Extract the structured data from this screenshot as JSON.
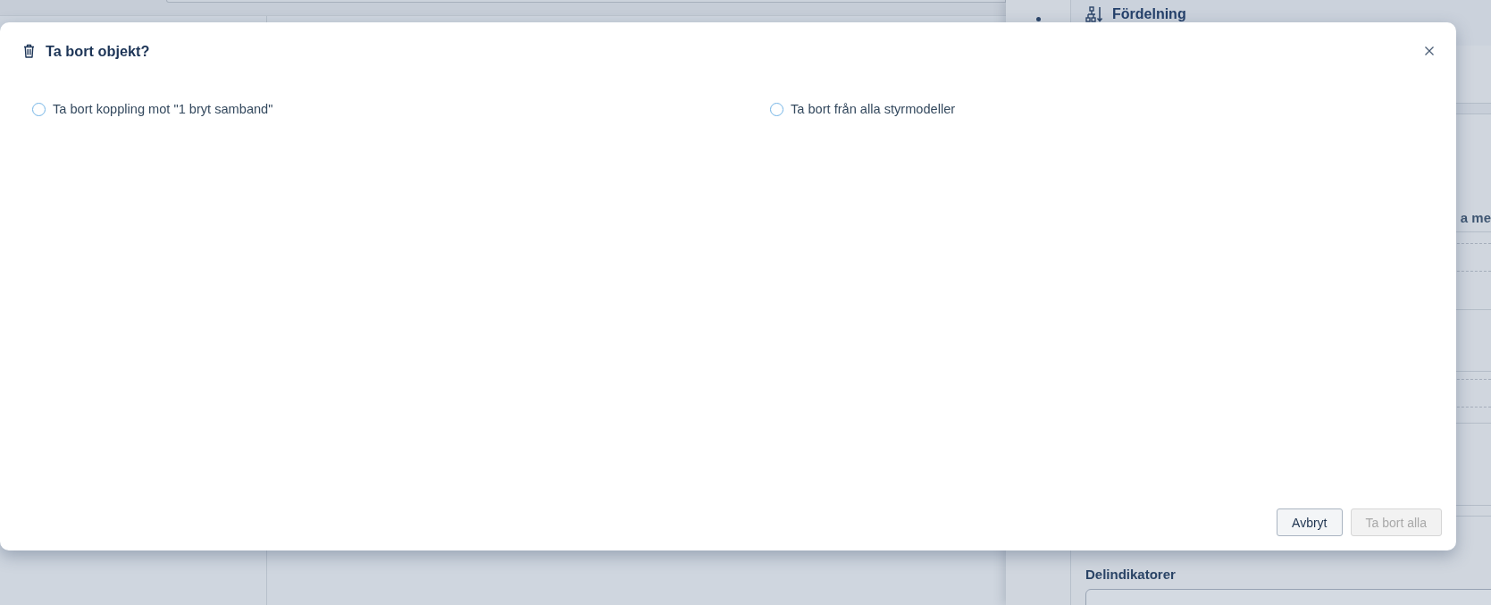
{
  "background": {
    "panel_title": "Fördelning",
    "column_label": "a me",
    "section_title": "Delindikatorer"
  },
  "dialog": {
    "title": "Ta bort objekt?",
    "options": [
      {
        "label": "Ta bort koppling mot \"1 bryt samband\"",
        "selected": false
      },
      {
        "label": "Ta bort från alla styrmodeller",
        "selected": false
      }
    ],
    "buttons": [
      {
        "label": "Avbryt",
        "disabled": false
      },
      {
        "label": "Ta bort alla",
        "disabled": true
      }
    ]
  }
}
